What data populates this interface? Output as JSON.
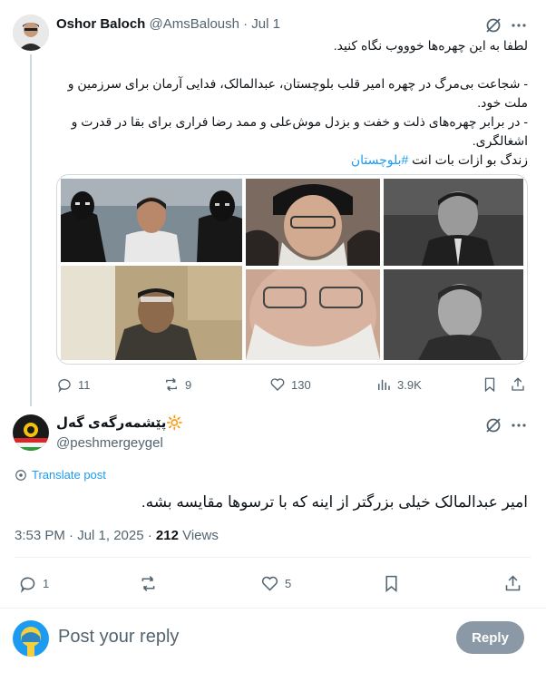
{
  "tweet1": {
    "author_name": "Oshor Baloch",
    "handle": "@AmsBaloush",
    "date": "· Jul 1",
    "line1": "لطفا به این چهره‌ها خوووب نگاه کنید.",
    "line2": "- شجاعت بی‌مرگ در چهره امیر قلب بلوچستان، عبدالمالک، فدایی آرمان برای سرزمین و",
    "line3": "ملت خود.",
    "line4": "- در برابر چهره‌های ذلت و خفت و بزدل موش‌علی و ممد رضا فراری برای بقا در قدرت و",
    "line5": "اشغالگری.",
    "line6_prefix": "زندگ بو ازات بات انت",
    "hashtag": "#بلوچستان",
    "stats": {
      "replies": "11",
      "reposts": "9",
      "likes": "130",
      "views": "3.9K"
    }
  },
  "tweet2": {
    "author_name": "پێشمەرگەی گەل",
    "name_emoji": "🔆",
    "handle": "@peshmergeygel",
    "translate": "Translate post",
    "text": "امیر عبدالمالک خیلی بزرگتر از اینه که با ترسوها مقایسه بشه.",
    "time": "3:53 PM · Jul 1, 2025 · ",
    "views_count": "212",
    "views_label": " Views",
    "stats": {
      "replies": "1",
      "reposts": "",
      "likes": "5"
    }
  },
  "reply_bar": {
    "placeholder": "Post your reply",
    "button": "Reply"
  },
  "colors": {
    "accent": "#1d9bf0",
    "muted": "#536471",
    "reply_button": "#8b98a5"
  }
}
